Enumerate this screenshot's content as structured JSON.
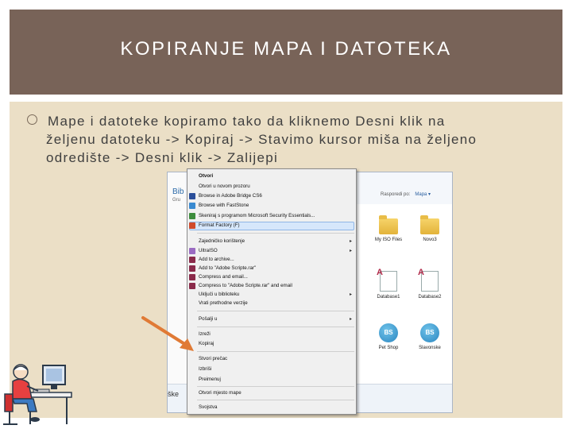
{
  "slide": {
    "title": "KOPIRANJE MAPA I DATOTEKA",
    "line1": "Mape i datoteke kopiramo tako da kliknemo Desni klik na",
    "line2": "željenu datoteku -> Kopiraj -> Stavimo kursor miša na željeno",
    "line3": "odredište -> Desni klik -> Zalijepi"
  },
  "explorer": {
    "library_title": "Bib",
    "library_sub": "Gru",
    "arrange_label": "Rasporedi po:",
    "arrange_value": "Mapa ▾",
    "status_text": "ške",
    "files": [
      {
        "label": "My ISO Files"
      },
      {
        "label": "Novo3"
      },
      {
        "label": "Database1"
      },
      {
        "label": "Database2"
      },
      {
        "label": "Pet Shop"
      },
      {
        "label": "Slavonske"
      }
    ]
  },
  "context_menu": {
    "items": [
      {
        "label": "Otvori",
        "bold": true
      },
      {
        "label": "Otvori u novom prozoru"
      },
      {
        "label": "Browse in Adobe Bridge CS6"
      },
      {
        "label": "Browse with FastStone"
      },
      {
        "label": "Skeniraj s programom Microsoft Security Essentials..."
      },
      {
        "label": "Format Factory (F)"
      },
      {
        "label": "Zajedničko korištenje"
      },
      {
        "label": "UltraISO"
      },
      {
        "label": "Add to archive..."
      },
      {
        "label": "Add to \"Adobe Scripte.rar\""
      },
      {
        "label": "Compress and email..."
      },
      {
        "label": "Compress to \"Adobe Scripte.rar\" and email"
      },
      {
        "label": "Uključi u biblioteku"
      },
      {
        "label": "Vrati prethodne verzije"
      },
      {
        "label": "Pošalji u"
      },
      {
        "label": "Izreži"
      },
      {
        "label": "Kopiraj"
      },
      {
        "label": "Stvori prečac"
      },
      {
        "label": "Izbriši"
      },
      {
        "label": "Preimenuj"
      },
      {
        "label": "Otvori mjesto mape"
      },
      {
        "label": "Svojstva"
      }
    ]
  },
  "colors": {
    "title_bar": "#786358",
    "content_bg": "#ebdfc6",
    "arrow": "#e07a35"
  }
}
